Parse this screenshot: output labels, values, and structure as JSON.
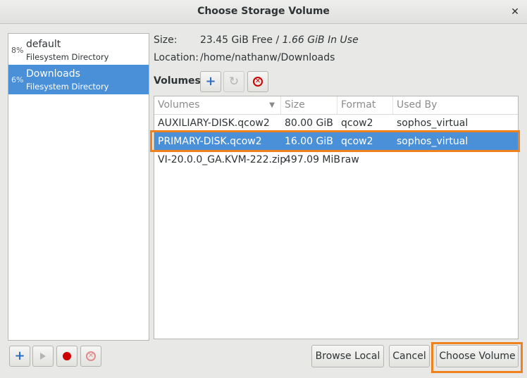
{
  "window": {
    "title": "Choose Storage Volume",
    "close_glyph": "✕"
  },
  "pools": [
    {
      "percent": "8%",
      "name": "default",
      "type": "Filesystem Directory",
      "selected": false
    },
    {
      "percent": "6%",
      "name": "Downloads",
      "type": "Filesystem Directory",
      "selected": true
    }
  ],
  "info": {
    "size_label": "Size:",
    "size_free": "23.45 GiB Free / ",
    "size_inuse": "1.66 GiB In Use",
    "location_label": "Location:",
    "location_value": "/home/nathanw/Downloads"
  },
  "volumes_toolbar": {
    "label": "Volumes",
    "add_icon": "plus-icon",
    "refresh_icon": "refresh-icon",
    "delete_icon": "delete-icon"
  },
  "volumes_table": {
    "columns": [
      "Volumes",
      "Size",
      "Format",
      "Used By"
    ],
    "rows": [
      {
        "name": "AUXILIARY-DISK.qcow2",
        "size": "80.00 GiB",
        "format": "qcow2",
        "used_by": "sophos_virtual",
        "selected": false
      },
      {
        "name": "PRIMARY-DISK.qcow2",
        "size": "16.00 GiB",
        "format": "qcow2",
        "used_by": "sophos_virtual",
        "selected": true
      },
      {
        "name": "VI-20.0.0_GA.KVM-222.zip",
        "size": "497.09 MiB",
        "format": "raw",
        "used_by": "",
        "selected": false
      }
    ]
  },
  "pool_toolbar": {
    "add_icon": "plus-icon",
    "start_icon": "play-icon",
    "stop_icon": "record-icon",
    "delete_icon": "delete-icon"
  },
  "buttons": {
    "browse_local": "Browse Local",
    "cancel": "Cancel",
    "choose_volume": "Choose Volume"
  },
  "colors": {
    "selection": "#4a90d9",
    "highlight": "#f0821e",
    "delete_red": "#cc0000"
  }
}
